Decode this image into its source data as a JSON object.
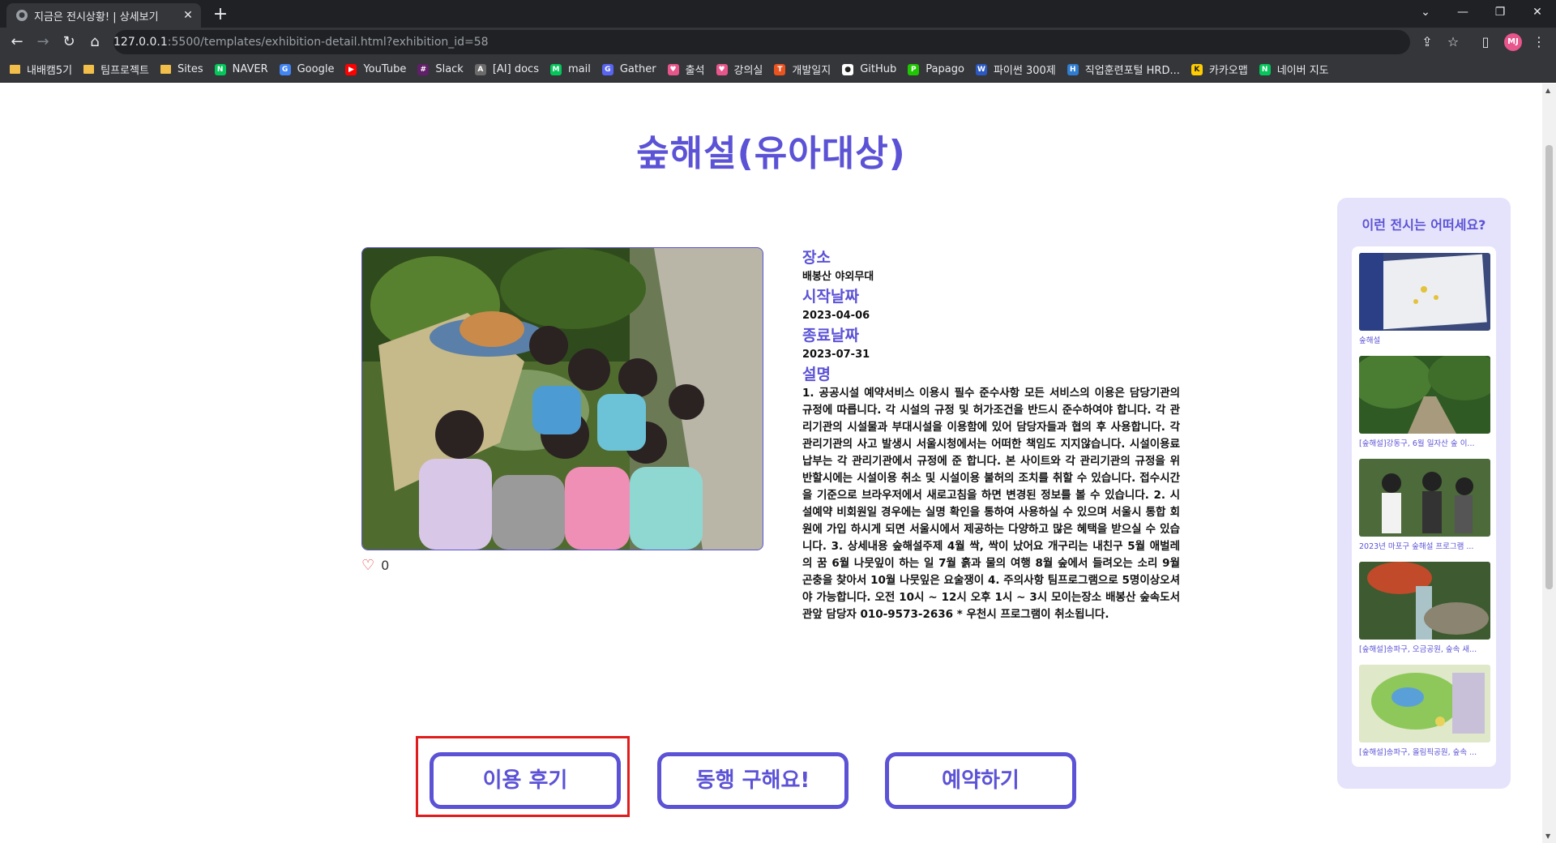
{
  "browser": {
    "tab_title": "지금은 전시상황! | 상세보기",
    "url_host": "127.0.0.1",
    "url_path": ":5500/templates/exhibition-detail.html?exhibition_id=58",
    "avatar_initials": "MJ",
    "bookmarks": [
      {
        "label": "내배캠5기",
        "icon": "folder-icon"
      },
      {
        "label": "팀프로젝트",
        "icon": "folder-icon"
      },
      {
        "label": "Sites",
        "icon": "folder-icon"
      },
      {
        "label": "NAVER",
        "icon": "naver-icon",
        "color": "#03c75a",
        "glyph": "N"
      },
      {
        "label": "Google",
        "icon": "google-icon",
        "color": "#4285f4",
        "glyph": "G"
      },
      {
        "label": "YouTube",
        "icon": "youtube-icon",
        "color": "#ff0000",
        "glyph": "▶"
      },
      {
        "label": "Slack",
        "icon": "slack-icon",
        "color": "#611f69",
        "glyph": "#"
      },
      {
        "label": "[AI] docs",
        "icon": "docs-icon",
        "color": "#6b6b6b",
        "glyph": "A"
      },
      {
        "label": "mail",
        "icon": "mail-icon",
        "color": "#03c75a",
        "glyph": "M"
      },
      {
        "label": "Gather",
        "icon": "gather-icon",
        "color": "#5865f2",
        "glyph": "G"
      },
      {
        "label": "출석",
        "icon": "heart-icon",
        "color": "#e8558a",
        "glyph": "♥"
      },
      {
        "label": "강의실",
        "icon": "heart-icon",
        "color": "#e8558a",
        "glyph": "♥"
      },
      {
        "label": "개발일지",
        "icon": "tistory-icon",
        "color": "#eb531f",
        "glyph": "T"
      },
      {
        "label": "GitHub",
        "icon": "github-icon",
        "color": "#ffffff",
        "glyph": "●"
      },
      {
        "label": "Papago",
        "icon": "papago-icon",
        "color": "#1ec800",
        "glyph": "P"
      },
      {
        "label": "파이썬 300제",
        "icon": "wikidocs-icon",
        "color": "#2b59c3",
        "glyph": "W"
      },
      {
        "label": "직업훈련포털 HRD...",
        "icon": "hrd-icon",
        "color": "#2e7dd1",
        "glyph": "H"
      },
      {
        "label": "카카오맵",
        "icon": "kakaomap-icon",
        "color": "#ffcd00",
        "glyph": "K"
      },
      {
        "label": "네이버 지도",
        "icon": "navermap-icon",
        "color": "#03c75a",
        "glyph": "N"
      }
    ]
  },
  "exhibition": {
    "title": "숲해설(유아대상)",
    "like_count": "0",
    "place_label": "장소",
    "place": "배봉산 야외무대",
    "start_label": "시작날짜",
    "start_date": "2023-04-06",
    "end_label": "종료날짜",
    "end_date": "2023-07-31",
    "desc_label": "설명",
    "description": "1. 공공시설 예약서비스 이용시 필수 준수사항 모든 서비스의 이용은 담당기관의 규정에 따릅니다. 각 시설의 규정 및 허가조건을 반드시 준수하여야 합니다. 각 관리기관의 시설물과 부대시설을 이용함에 있어 담당자들과 협의 후 사용합니다. 각 관리기관의 사고 발생시 서울시청에서는 어떠한 책임도 지지않습니다. 시설이용료 납부는 각 관리기관에서 규정에 준 합니다. 본 사이트와 각 관리기관의 규정을 위반할시에는 시설이용 취소 및 시설이용 불허의 조치를 취할 수 있습니다. 접수시간을 기준으로 브라우저에서 새로고침을 하면 변경된 정보를 볼 수 있습니다. 2. 시설예약 비회원일 경우에는 실명 확인을 통하여 사용하실 수 있으며 서울시 통합 회원에 가입 하시게 되면 서울시에서 제공하는 다양하고 많은 혜택을 받으실 수 있습니다. 3. 상세내용 숲해설주제 4월 싹, 싹이 났어요 개구리는 내친구 5월 애벌레의 꿈 6월 나뭇잎이 하는 일 7월 흙과 물의 여행 8월 숲에서 들려오는 소리 9월 곤충을 찾아서 10월  나뭇잎은 요술쟁이 4. 주의사항 팀프로그램으로 5명이상오셔야 가능합니다. 오전 10시 ~ 12시 오후  1시 ~  3시   모이는장소 배봉산 숲속도서관앞 담당자 010-9573-2636 * 우천시 프로그램이 취소됩니다."
  },
  "buttons": {
    "review": "이용 후기",
    "companion": "동행 구해요!",
    "reserve": "예약하기"
  },
  "sidebar": {
    "heading": "이런 전시는 어떠세요?",
    "items": [
      {
        "caption": "숲해설"
      },
      {
        "caption": "[숲해설]강동구, 6월 일자산 숲 이..."
      },
      {
        "caption": "2023년 마포구 숲해설 프로그램 ..."
      },
      {
        "caption": "[숲해설]송파구, 오금공원, 숲속 새..."
      },
      {
        "caption": "[숲해설]송파구, 올림픽공원, 숲속 ..."
      }
    ]
  },
  "colors": {
    "accent": "#5b52d6",
    "sidebar_bg": "#e5e3fb",
    "focus_outline": "#e11c1c",
    "heart": "#e23b3b"
  }
}
